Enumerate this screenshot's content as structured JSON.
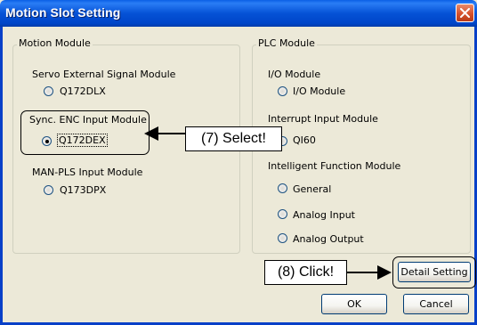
{
  "window": {
    "title": "Motion Slot Setting",
    "close_icon": "close-icon"
  },
  "motion_module": {
    "legend": "Motion Module",
    "servo_heading": "Servo External Signal Module",
    "servo_option": "Q172DLX",
    "sync_heading": "Sync. ENC Input Module",
    "sync_option": "Q172DEX",
    "manpls_heading": "MAN-PLS Input Module",
    "manpls_option": "Q173DPX"
  },
  "plc_module": {
    "legend": "PLC Module",
    "io_heading": "I/O Module",
    "io_option": "I/O Module",
    "interrupt_heading": "Interrupt Input Module",
    "interrupt_option": "QI60",
    "intelligent_heading": "Intelligent Function Module",
    "intelligent_options": [
      "General",
      "Analog Input",
      "Analog Output"
    ]
  },
  "buttons": {
    "detail_setting": "Detail Setting",
    "ok": "OK",
    "cancel": "Cancel"
  },
  "annotations": {
    "select_callout": "(7) Select!",
    "click_callout": "(8) Click!"
  },
  "selected_option": "Q172DEX"
}
